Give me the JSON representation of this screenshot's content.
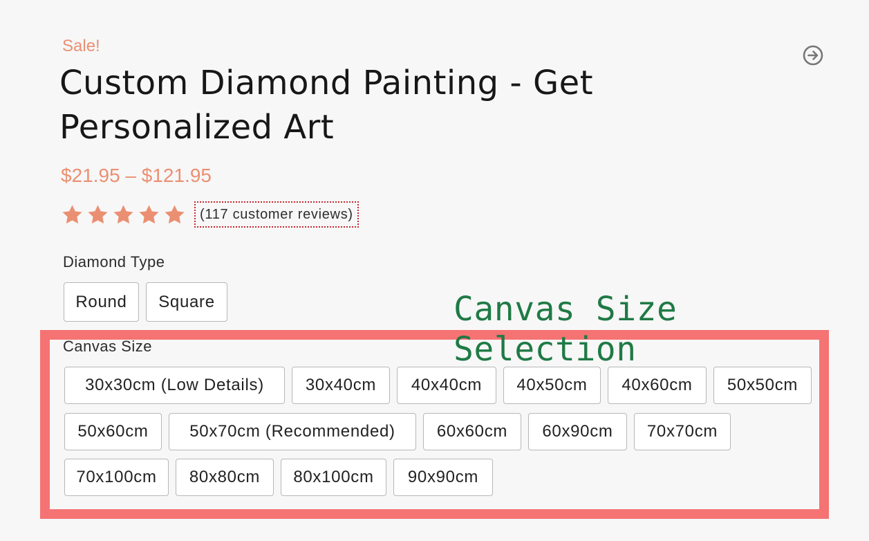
{
  "product": {
    "sale_badge": "Sale!",
    "title": "Custom Diamond Painting - Get Personalized Art",
    "price_range": "$21.95 – $121.95",
    "rating": 5,
    "rating_max": 5,
    "reviews_link": "(117 customer reviews)"
  },
  "diamond_type": {
    "label": "Diamond Type",
    "options": [
      "Round",
      "Square"
    ]
  },
  "canvas_size": {
    "label": "Canvas Size",
    "options": [
      "30x30cm (Low Details)",
      "30x40cm",
      "40x40cm",
      "40x50cm",
      "40x60cm",
      "50x50cm",
      "50x60cm",
      "50x70cm (Recommended)",
      "60x60cm",
      "60x90cm",
      "70x70cm",
      "70x100cm",
      "80x80cm",
      "80x100cm",
      "90x90cm"
    ]
  },
  "annotation": {
    "text": "Canvas Size Selection"
  },
  "icons": {
    "next": "arrow-right-circle-icon",
    "star": "star-icon"
  },
  "colors": {
    "accent": "#eb8f72",
    "highlight_border": "#f57373",
    "annotation_text": "#1f7a45",
    "reviews_outline": "#c4272f",
    "background": "#f7f7f7"
  }
}
